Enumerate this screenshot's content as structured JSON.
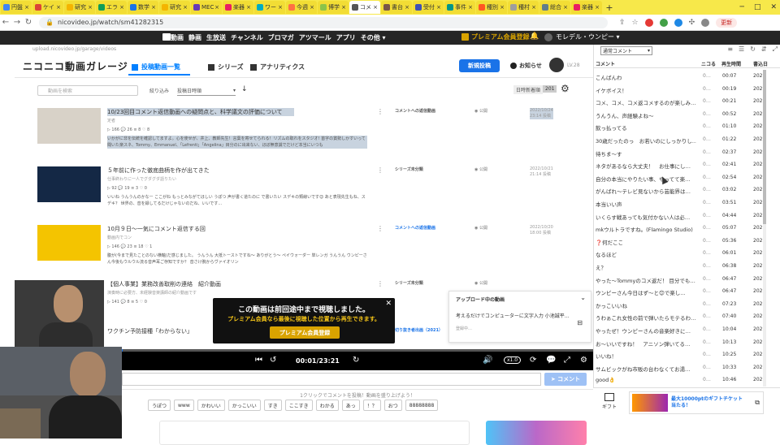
{
  "browser": {
    "tabs": [
      {
        "label": "円盤",
        "color": "#4285f4"
      },
      {
        "label": "ケイ",
        "color": "#db4437"
      },
      {
        "label": "研究",
        "color": "#f4b400"
      },
      {
        "label": "エラ",
        "color": "#0f9d58"
      },
      {
        "label": "数学",
        "color": "#1a73e8"
      },
      {
        "label": "研究",
        "color": "#f4b400"
      },
      {
        "label": "MEC",
        "color": "#673ab7"
      },
      {
        "label": "楽器",
        "color": "#e91e63"
      },
      {
        "label": "ワー",
        "color": "#00acc1"
      },
      {
        "label": "今週",
        "color": "#ff7043"
      },
      {
        "label": "博学",
        "color": "#8bc34a"
      },
      {
        "label": "コメ",
        "color": "#555555",
        "active": true
      },
      {
        "label": "書台",
        "color": "#795548"
      },
      {
        "label": "受付",
        "color": "#3f51b5"
      },
      {
        "label": "事件",
        "color": "#009688"
      },
      {
        "label": "種別",
        "color": "#ff5722"
      },
      {
        "label": "種村",
        "color": "#9e9e9e"
      },
      {
        "label": "総合",
        "color": "#607d8b"
      },
      {
        "label": "楽器",
        "color": "#e91e63"
      }
    ],
    "url": "nicovideo.jp/watch/sm41282315",
    "update_label": "更新"
  },
  "nico_header": {
    "menu": [
      "動画",
      "静画",
      "生放送",
      "チャンネル",
      "ブロマガ",
      "アツマール",
      "アプリ",
      "その他 ▾"
    ],
    "premium_label": "プレミアム会員登録",
    "user_name": "モレデル・ウンピー ▾"
  },
  "garage": {
    "url": "upload.nicovideo.jp/garage/videos",
    "logo": "ニコニコ動画ガレージ",
    "nav_posted": "投稿動画一覧",
    "nav_series": "シリーズ",
    "nav_analytics": "アナリティクス",
    "post_button": "新規投稿",
    "notice": "お知らせ",
    "level": "LV.28",
    "search_placeholder": "動画を検索",
    "filter_label": "絞り込み",
    "sort_label": "投稿日時順",
    "date_sort": "日時新着順",
    "date_count": "201",
    "videos": [
      {
        "title": "10/23回目コメント返信動画への疑問点と、科学議文の評価について",
        "sub": "定者",
        "stats": "▷ 166  💬 26  ≡ 8  ♡ 8",
        "comments": "いかがに非を伝統を確認してますよ。心を使せが、井上、教師先生！言葉を寄せてられる！リズムの取れをスタジオ! 首字の賞勢しかすいって聞いた楽スネ、Tommy、Emmanuel、「Lefrenti」「Angelina」目分のに出来ない、ほぼ無意識でだけど本当にいつも",
        "status": "コメントへの返信動画",
        "vis": "公開",
        "date": "2022/10/24\n23:14 投稿"
      },
      {
        "title": "５年前に作った徹底曲柄を作が出てきた",
        "sub": "仕事終わりに一人でグダグダ語りたい",
        "stats": "▷ 92  💬 19  ≡ 3  ♡ 0",
        "comments": "いいね うんうんのかなー ここがね もっとみながてほしい うぽつ 声が書く道たのに で書いたい スデキの類線いです😊 あと表現先生もね、スデキ？ 世界の、音を録してるだけじゃないのだね、いいです…",
        "status": "シリーズ未分類",
        "vis": "公開",
        "date": "2022/10/21\n21:14 投稿"
      },
      {
        "title": "10月９日～一気にコメント返信する回",
        "sub": "動画内でコン",
        "stats": "▷ 146  💬 23  ≡ 18  ♡ 1",
        "comments": "腹が(今まで見たことのない横軸)だ感じました。 うんうん 大抵トーストですね～ ありがとう～ ペイウォーダー 単レンガ うんうん ウンピーさん今後もウルウル流る音声耳ご存知ですか？ 音さけ腕からヴァイオリン",
        "status": "コメントへの返信動画",
        "vis": "公開",
        "date": "2022/10/20\n18:00 投稿"
      },
      {
        "title": "【個人事業】業務改善取削の連絡　紹介動画",
        "sub": "演奏時に必要方、未経験音楽講師の紹介動画です",
        "stats": "▷ 141  💬 8  ≡ 5  ♡ 0",
        "comments": "",
        "status": "シリーズ未分類",
        "vis": "公開",
        "date": ""
      },
      {
        "title": "ワクチン予防接種「わからない」",
        "sub": "",
        "stats": "",
        "comments": "",
        "status": "切り抜き者出画（2021）",
        "vis": "",
        "date": ""
      }
    ]
  },
  "player": {
    "resume_title": "この動画は前回途中まで視聴しました。",
    "resume_text": "プレミアム会員なら最後に視聴した位置から再生できます。",
    "resume_button": "プレミアム会員登録",
    "time": "00:01/23:21",
    "speed": "x1.0",
    "progress": 0.001
  },
  "upload_panel": {
    "header": "アップロード中の動画",
    "file": "考えるだけでコンピューターに文字入力 小池誠平…",
    "status": "登録中…"
  },
  "comment_form": {
    "submit": "➤ コメント",
    "prompt": "1クリックでコメントを投稿！動画を盛り上げよう！",
    "quick": [
      "うぽつ",
      "www",
      "かわいい",
      "かっこいい",
      "すき",
      "ここすき",
      "わかる",
      "あっ",
      "！？",
      "おつ",
      "88888888"
    ]
  },
  "comments_panel": {
    "select": "通常コメント",
    "head_comment": "コメント",
    "head_niko": "ニコる",
    "head_time": "再生時間",
    "head_date": "書込日",
    "rows": [
      {
        "c": "こんばんわ",
        "t": "00:07"
      },
      {
        "c": "イケボイス！",
        "t": "00:19"
      },
      {
        "c": "コメ、コメ、コメ返コメするのが楽しみ…",
        "t": "00:21"
      },
      {
        "c": "うんうん、声経験よね～",
        "t": "00:52"
      },
      {
        "c": "飲っ払ってる",
        "t": "01:10"
      },
      {
        "c": "30歳だったのっ　お若いのにしっかりし…",
        "t": "01:22"
      },
      {
        "c": "待ちま～す",
        "t": "02:37"
      },
      {
        "c": "ネタがあるなら大丈夫！　お仕事にし…",
        "t": "02:41"
      },
      {
        "c": "自分の本当にやりたい事、やってて楽…",
        "t": "02:54"
      },
      {
        "c": "がんばれ～テレビ見ないから芸能界は…",
        "t": "03:02"
      },
      {
        "c": "本当いい声",
        "t": "03:51"
      },
      {
        "c": "いくらす戦あっても気付かない人は必…",
        "t": "04:44"
      },
      {
        "c": "mkウルトラですね。(Flamingo Studio)",
        "t": "05:07"
      },
      {
        "c": "❓何だここ",
        "t": "05:36"
      },
      {
        "c": "なるほど",
        "t": "06:01"
      },
      {
        "c": "え？",
        "t": "06:38"
      },
      {
        "c": "やった～Tommyのコメ返だ！ 目分でも…",
        "t": "06:47"
      },
      {
        "c": "ウンピーさん今日はず～と😊で楽し…",
        "t": "06:47"
      },
      {
        "c": "かっこいいね",
        "t": "07:23"
      },
      {
        "c": "うわぁこれ女性の前で弾いたらモテるわ…",
        "t": "07:40"
      },
      {
        "c": "やったぜ！ウンピーさんの音楽好きに…",
        "t": "10:04"
      },
      {
        "c": "お～いいですね！　アニソン弾いてる…",
        "t": "10:13"
      },
      {
        "c": "いいね！",
        "t": "10:25"
      },
      {
        "c": "サムビックがね市販の台わなくてお湯…",
        "t": "10:33"
      },
      {
        "c": "good👌",
        "t": "10:46"
      }
    ],
    "niko": "0…",
    "year": "202"
  },
  "gift": {
    "label": "ギフト",
    "ad_line1": "最大10000ptのギフトチケット",
    "ad_line2": "当たる！"
  }
}
